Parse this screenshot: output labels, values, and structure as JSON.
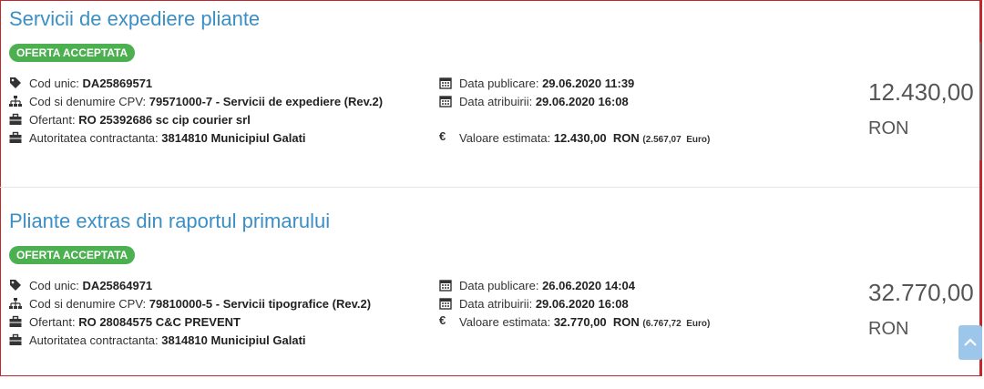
{
  "colors": {
    "accent": "#3b8fc4",
    "badge": "#4caf50",
    "frame": "#c0282d"
  },
  "items": [
    {
      "title": "Servicii de expediere pliante",
      "status": "OFERTA ACCEPTATA",
      "cod_unic_label": "Cod unic:",
      "cod_unic": "DA25869571",
      "cpv_label": "Cod si denumire CPV:",
      "cpv": "79571000-7 - Servicii de expediere (Rev.2)",
      "ofertant_label": "Ofertant:",
      "ofertant": "RO 25392686 sc cip courier srl",
      "autoritate_label": "Autoritatea contractanta:",
      "autoritate": "3814810 Municipiul Galati",
      "data_publicare_label": "Data publicare:",
      "data_publicare": "29.06.2020 11:39",
      "data_atribuirii_label": "Data atribuirii:",
      "data_atribuirii": "29.06.2020 16:08",
      "valoare_label": "Valoare estimata:",
      "valoare": "12.430,00  RON",
      "valoare_euro": "(2.567,07  Euro)",
      "amount": "12.430,00",
      "currency": "RON"
    },
    {
      "title": "Pliante extras din raportul primarului",
      "status": "OFERTA ACCEPTATA",
      "cod_unic_label": "Cod unic:",
      "cod_unic": "DA25864971",
      "cpv_label": "Cod si denumire CPV:",
      "cpv": "79810000-5 - Servicii tipografice (Rev.2)",
      "ofertant_label": "Ofertant:",
      "ofertant": "RO 28084575 C&C PREVENT",
      "autoritate_label": "Autoritatea contractanta:",
      "autoritate": "3814810 Municipiul Galati",
      "data_publicare_label": "Data publicare:",
      "data_publicare": "26.06.2020 14:04",
      "data_atribuirii_label": "Data atribuirii:",
      "data_atribuirii": "29.06.2020 16:08",
      "valoare_label": "Valoare estimata:",
      "valoare": "32.770,00  RON",
      "valoare_euro": "(6.767,72  Euro)",
      "amount": "32.770,00",
      "currency": "RON"
    }
  ],
  "icons": [
    "tag-icon",
    "sitemap-icon",
    "briefcase-icon",
    "calendar-icon",
    "euro-icon",
    "chevron-up-icon"
  ]
}
